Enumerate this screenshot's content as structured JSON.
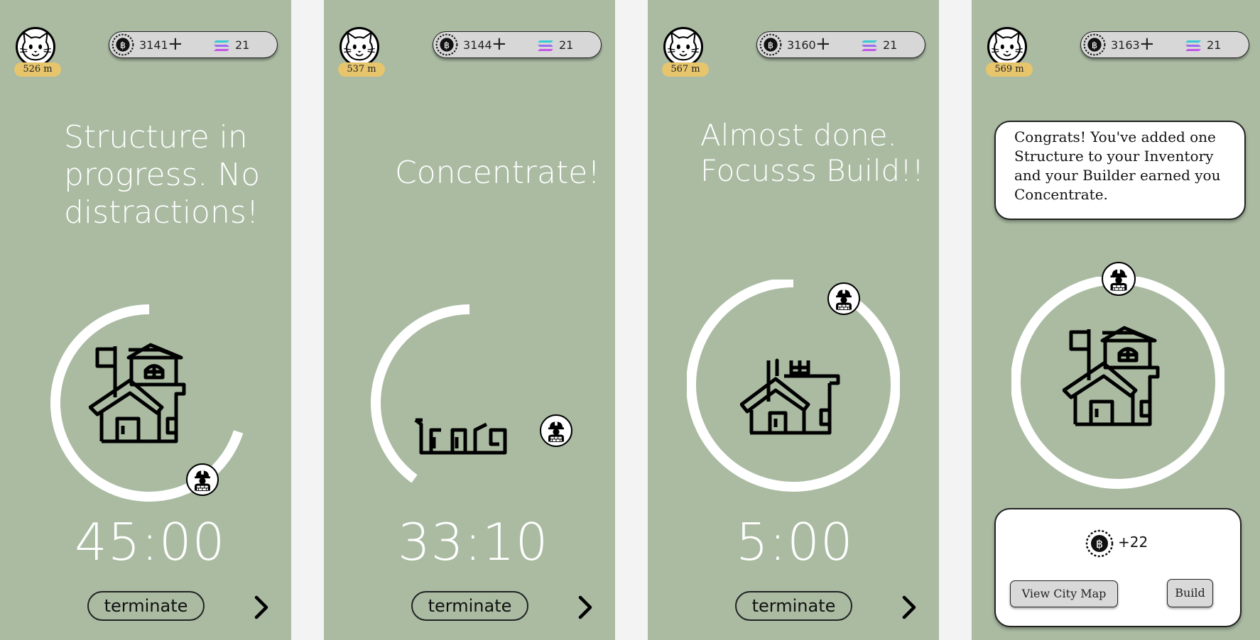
{
  "screens": [
    {
      "distance": "526 m",
      "coins": "3141",
      "gems": "21",
      "message": "Structure in progress. No distractions!",
      "timer": "45:00",
      "terminate_label": "terminate",
      "progress": 0.7
    },
    {
      "distance": "537 m",
      "coins": "3144",
      "gems": "21",
      "message": "Concentrate!",
      "timer": "33:10",
      "terminate_label": "terminate",
      "progress": 0.4
    },
    {
      "distance": "567 m",
      "coins": "3160",
      "gems": "21",
      "message": "Almost done. Focusss Build!!",
      "timer": "5:00",
      "terminate_label": "terminate",
      "progress": 0.93
    },
    {
      "distance": "569 m",
      "coins": "3163",
      "gems": "21",
      "congrats": "Congrats! You've added one Structure to your Inventory and your Builder earned you Concentrate.",
      "reward": "+22",
      "view_map_label": "View City Map",
      "build_label": "Build",
      "progress": 1.0
    }
  ],
  "icons": {
    "avatar": "cat-face-icon",
    "coin": "coin-icon",
    "add": "plus-icon",
    "gems": "gem-stack-icon",
    "builder": "builder-worker-icon",
    "structure": "house-building-icon",
    "next": "chevron-right-icon"
  },
  "colors": {
    "screen_bg": "#aabba2",
    "badge": "#e7c56c",
    "ring": "#ffffff",
    "page_bg": "#f3f3f3"
  }
}
